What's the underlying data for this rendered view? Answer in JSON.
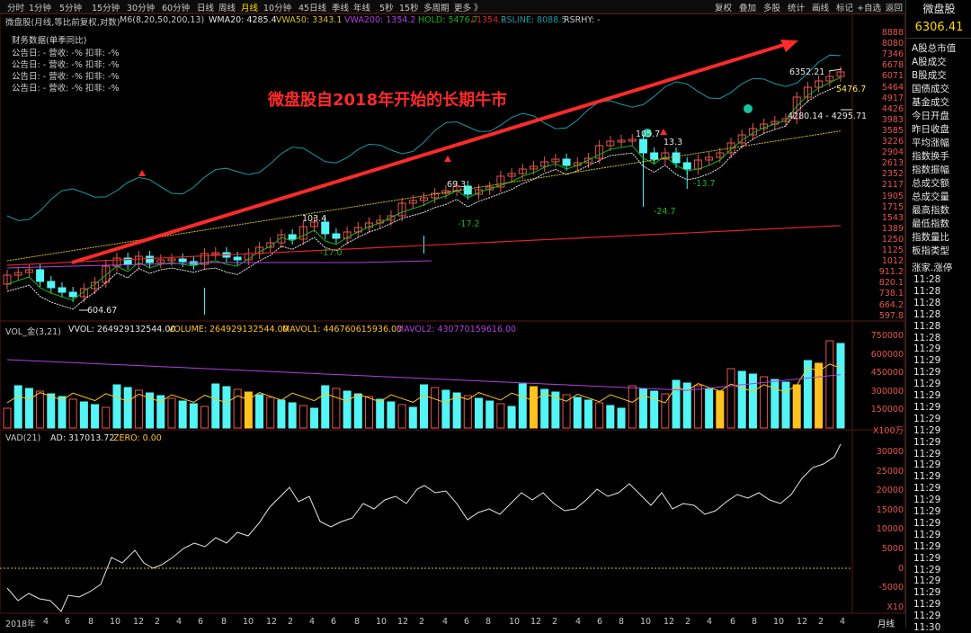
{
  "toolbar": {
    "periods": [
      "分时",
      "1分钟",
      "5分钟",
      "15分钟",
      "30分钟",
      "60分钟",
      "日线",
      "周线",
      "月线",
      "10分钟",
      "45日线",
      "季线",
      "年线",
      "5秒",
      "15秒",
      "多周期",
      "更多 》"
    ],
    "active_period": "月线",
    "right_tools": [
      "复权",
      "叠加",
      "多股",
      "统计",
      "画线",
      "标记",
      "+自选",
      "返回"
    ]
  },
  "main_info": {
    "title": "微盘股(月线,等比前复权,对数)",
    "ma": "M6(8,20,50,200,13)",
    "wma20": "WMA20: 4285.4",
    "vwa50": "VWA50: 3343.1",
    "vwa200": "VWA200: 1354.2",
    "hold": "HOLD: 5476.7",
    "mark": "↓1354.2",
    "rsline": "RSLINE: 8088.5",
    "rsrhy": "RSRHY: -"
  },
  "finance": {
    "header": "财务数据(单季同比)",
    "rows": [
      "公告日: -    营收: -%    扣非: -%",
      "公告日: -    营收: -%    扣非: -%",
      "公告日: -    营收: -%    扣非: -%",
      "公告日: -    营收: -%    扣非: -%"
    ]
  },
  "annotation": "微盘股自2018年开始的长期牛市",
  "price_labels": {
    "high": "6352.21",
    "low": "604.67",
    "hold": "5476.7",
    "range": "4280.14 - 4295.71",
    "p1": "103.4",
    "p2": "-17.0",
    "p3": "69.3",
    "p4": "-17.2",
    "p5": "105.7",
    "p6": "-24.7",
    "p7": "13.3",
    "p8": "-13.7"
  },
  "price_axis": [
    "8888",
    "8080",
    "7346",
    "6678",
    "6071",
    "5464",
    "4917",
    "4426",
    "3983",
    "3585",
    "3226",
    "2904",
    "2613",
    "2352",
    "2117",
    "1905",
    "1715",
    "1543",
    "1389",
    "1250",
    "1125",
    "1012",
    "911.2",
    "820.1",
    "738.1",
    "664.2",
    "597.8"
  ],
  "vol_info": {
    "title": "VOL_金(3,21)",
    "vvol": "VVOL: 264929132544.00",
    "volume": "VOLUME: 264929132544.00",
    "mavol1": "MAVOL1: 446760615936.00",
    "mavol2": "MAVOL2: 430770159616.00"
  },
  "vol_axis": [
    "750000",
    "600000",
    "450000",
    "300000",
    "150000",
    "X100万"
  ],
  "vad_info": {
    "title": "VAD(21)",
    "ad": "AD: 317013.72",
    "zero": "ZERO: 0.00"
  },
  "vad_axis": [
    "30000",
    "25000",
    "20000",
    "15000",
    "10000",
    "5000",
    "0",
    "-5000",
    "X10"
  ],
  "x_axis": [
    "2018年",
    "4",
    "6",
    "8",
    "10",
    "12",
    "2",
    "4",
    "6",
    "8",
    "10",
    "12",
    "2",
    "4",
    "6",
    "8",
    "10",
    "12",
    "2",
    "4",
    "6",
    "8",
    "10",
    "12",
    "2",
    "4",
    "6",
    "8",
    "10",
    "12",
    "2",
    "4",
    "6",
    "8",
    "10",
    "12",
    "2",
    "4",
    "6",
    "8",
    "10",
    "12",
    "2",
    "4",
    "6",
    "8",
    "10"
  ],
  "x_unit": "月线",
  "sidebar": {
    "title": "微盘股",
    "price": "6306.41",
    "items": [
      "A股总市值",
      "A股成交",
      "B股成交",
      "国债成交",
      "基金成交",
      "今日开盘",
      "昨日收盘",
      "平均涨幅",
      "指数换手",
      "指数振幅",
      "总成交额",
      "总成交量",
      "最高指数",
      "最低指数",
      "指数量比",
      "板指类型",
      "涨家.涨停"
    ],
    "times": [
      "11:28",
      "11:28",
      "11:28",
      "11:28",
      "11:28",
      "11:28",
      "11:29",
      "11:29",
      "11:29",
      "11:29",
      "11:29",
      "11:29",
      "11:29",
      "11:29",
      "11:29",
      "11:29",
      "11:29",
      "11:29",
      "11:29",
      "11:29",
      "11:29",
      "11:29",
      "11:29",
      "11:29",
      "11:29",
      "11:29",
      "11:29",
      "11:29",
      "11:29",
      "11:29",
      "11:30"
    ]
  },
  "colors": {
    "up": "#e8564c",
    "down": "#53f5f5",
    "gold": "#ffc21f",
    "mavol2": "#b040e0",
    "vwa50": "#d4c12a",
    "vwa200": "#e0232b",
    "hold": "#19b319",
    "rsline": "#179aa8",
    "arrow": "#ff2a2a"
  }
}
